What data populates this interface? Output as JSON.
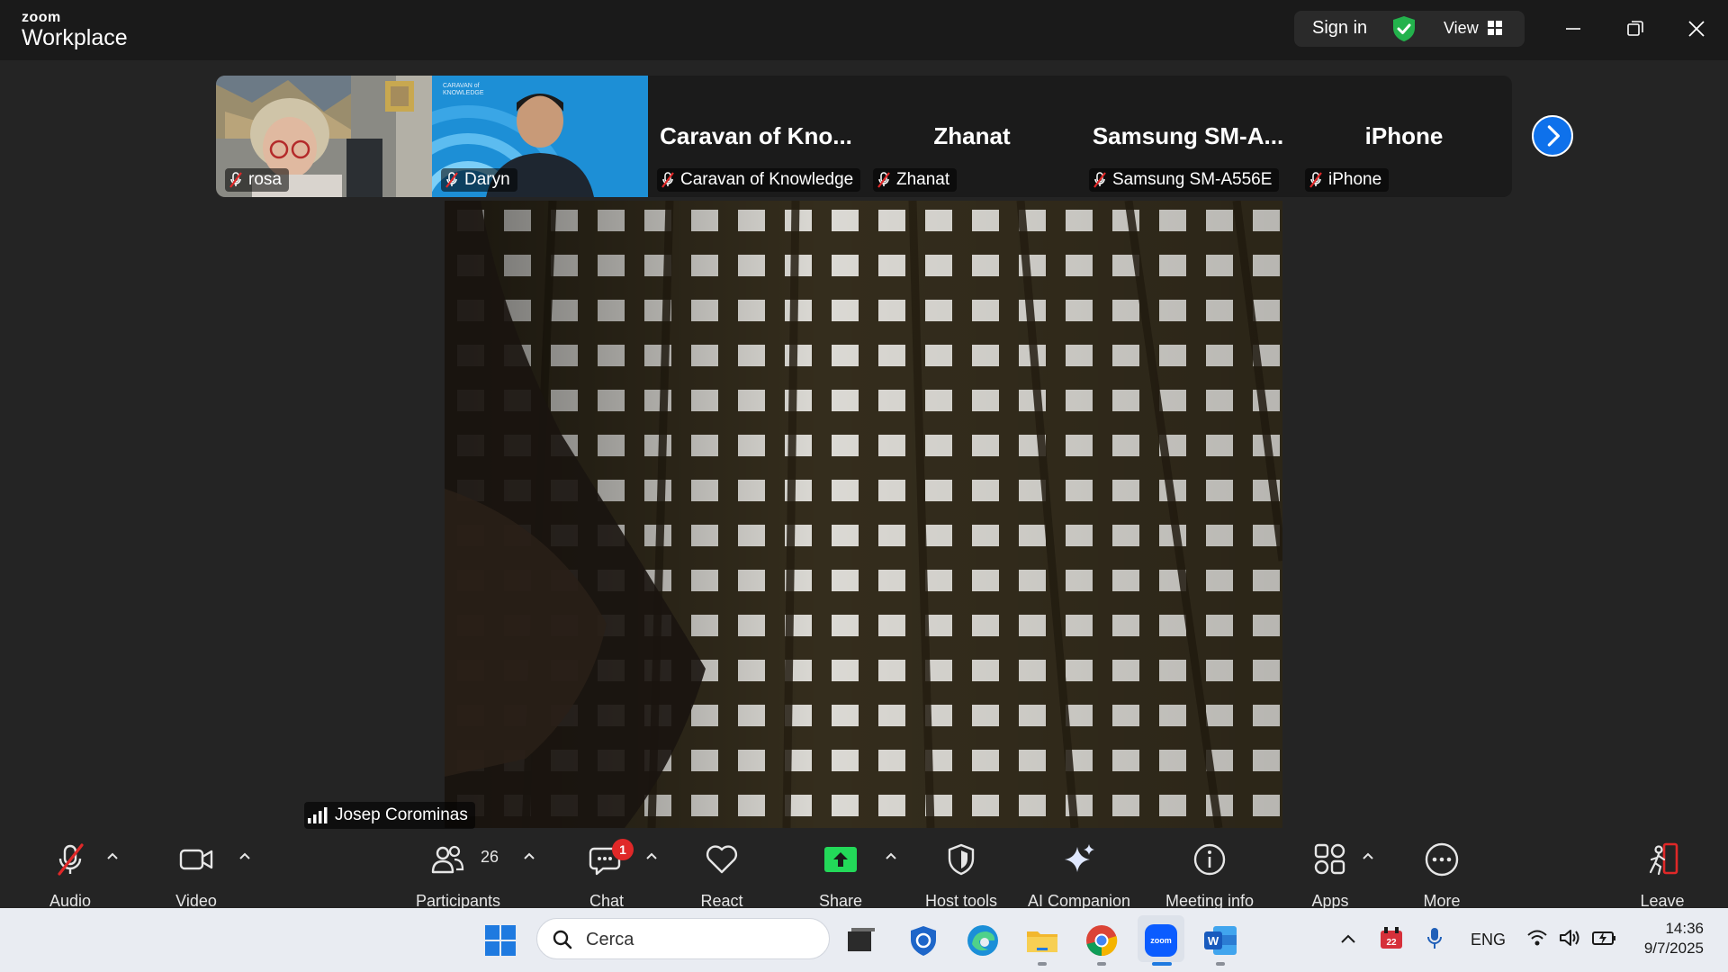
{
  "titlebar": {
    "logo_small": "zoom",
    "logo_big": "Workplace",
    "sign_in": "Sign in",
    "view": "View",
    "icons": [
      "shield-check-icon",
      "grid-icon",
      "minimize-icon",
      "restore-icon",
      "close-icon"
    ]
  },
  "thumbnails": [
    {
      "name": "rosa",
      "display": "video",
      "muted": true
    },
    {
      "name": "Daryn",
      "display": "video",
      "muted": true
    },
    {
      "name": "Caravan of Knowledge",
      "display": "Caravan of Kno...",
      "muted": true
    },
    {
      "name": "Zhanat",
      "display": "Zhanat",
      "muted": true
    },
    {
      "name": "Samsung SM-A556E",
      "display": "Samsung SM-A...",
      "muted": true
    },
    {
      "name": "iPhone",
      "display": "iPhone",
      "muted": true
    }
  ],
  "daryn_bg_text": "CARAVAN of KNOWLEDGE",
  "main_speaker": "Josep Corominas",
  "toolbar": {
    "audio": "Audio",
    "video": "Video",
    "participants": "Participants",
    "participants_count": "26",
    "chat": "Chat",
    "chat_badge": "1",
    "react": "React",
    "share": "Share",
    "host_tools": "Host tools",
    "ai_companion": "AI Companion",
    "meeting_info": "Meeting info",
    "apps": "Apps",
    "more": "More",
    "leave": "Leave"
  },
  "taskbar": {
    "search_placeholder": "Cerca",
    "language": "ENG",
    "calendar_day": "22",
    "time": "14:36",
    "date": "9/7/2025"
  },
  "colors": {
    "accent": "#0e71eb",
    "share_green": "#23d959",
    "mute_red": "#e02828",
    "shield_green": "#23b24c"
  }
}
